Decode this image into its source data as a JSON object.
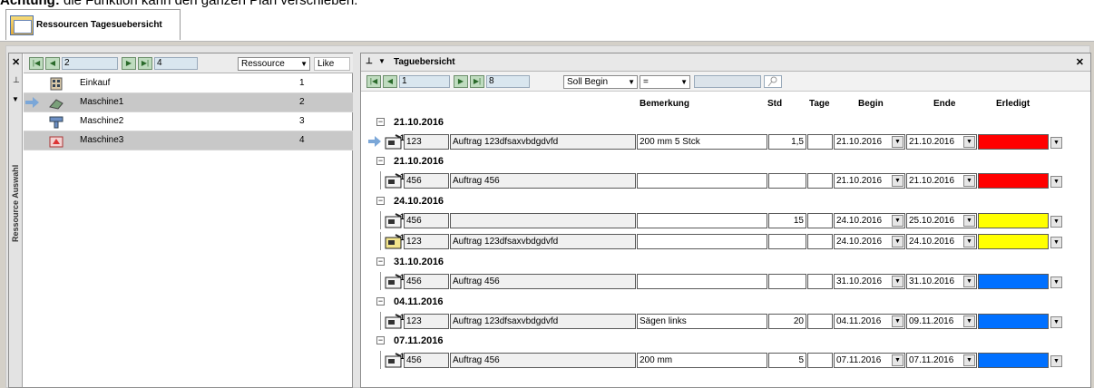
{
  "caption": {
    "bold": "Achtung:",
    "rest": " die Funktion kann den ganzen Plan verschieben."
  },
  "tab": {
    "label": "Ressourcen Tagesuebersicht"
  },
  "left": {
    "side_title": "Ressource Auswahl",
    "nav": {
      "current": "2",
      "total": "4"
    },
    "column_combo": "Ressource",
    "filter_combo": "Like",
    "rows": [
      {
        "name": "Einkauf",
        "num": "1"
      },
      {
        "name": "Maschine1",
        "num": "2"
      },
      {
        "name": "Maschine2",
        "num": "3"
      },
      {
        "name": "Maschine3",
        "num": "4"
      }
    ]
  },
  "right": {
    "title": "Taguebersicht",
    "nav": {
      "current": "1",
      "total": "8"
    },
    "field_combo": "Soll Begin",
    "op_combo": "=",
    "columns": {
      "bemerkung": "Bemerkung",
      "std": "Std",
      "tage": "Tage",
      "begin": "Begin",
      "ende": "Ende",
      "erledigt": "Erledigt"
    },
    "groups": [
      {
        "date": "21.10.2016"
      },
      {
        "date": "21.10.2016"
      },
      {
        "date": "24.10.2016"
      },
      {
        "date": "31.10.2016"
      },
      {
        "date": "04.11.2016"
      },
      {
        "date": "07.11.2016"
      }
    ],
    "rows": [
      {
        "id": "123",
        "auftrag": "Auftrag 123dfsaxvbdgdvfd",
        "bemerkung": "200 mm 5 Stck",
        "std": "1,5",
        "tage": "",
        "begin": "21.10.2016",
        "ende": "21.10.2016",
        "color": "#ff0000"
      },
      {
        "id": "456",
        "auftrag": "Auftrag 456",
        "bemerkung": "",
        "std": "",
        "tage": "",
        "begin": "21.10.2016",
        "ende": "21.10.2016",
        "color": "#ff0000"
      },
      {
        "id": "456",
        "auftrag": "",
        "bemerkung": "",
        "std": "15",
        "tage": "",
        "begin": "24.10.2016",
        "ende": "25.10.2016",
        "color": "#ffff00"
      },
      {
        "id": "123",
        "auftrag": "Auftrag 123dfsaxvbdgdvfd",
        "bemerkung": "",
        "std": "",
        "tage": "",
        "begin": "24.10.2016",
        "ende": "24.10.2016",
        "color": "#ffff00"
      },
      {
        "id": "456",
        "auftrag": "Auftrag 456",
        "bemerkung": "",
        "std": "",
        "tage": "",
        "begin": "31.10.2016",
        "ende": "31.10.2016",
        "color": "#0070ff"
      },
      {
        "id": "123",
        "auftrag": "Auftrag 123dfsaxvbdgdvfd",
        "bemerkung": "Sägen links",
        "std": "20",
        "tage": "",
        "begin": "04.11.2016",
        "ende": "09.11.2016",
        "color": "#0070ff"
      },
      {
        "id": "456",
        "auftrag": "Auftrag 456",
        "bemerkung": "200 mm",
        "std": "5",
        "tage": "",
        "begin": "07.11.2016",
        "ende": "07.11.2016",
        "color": "#0070ff"
      }
    ]
  }
}
